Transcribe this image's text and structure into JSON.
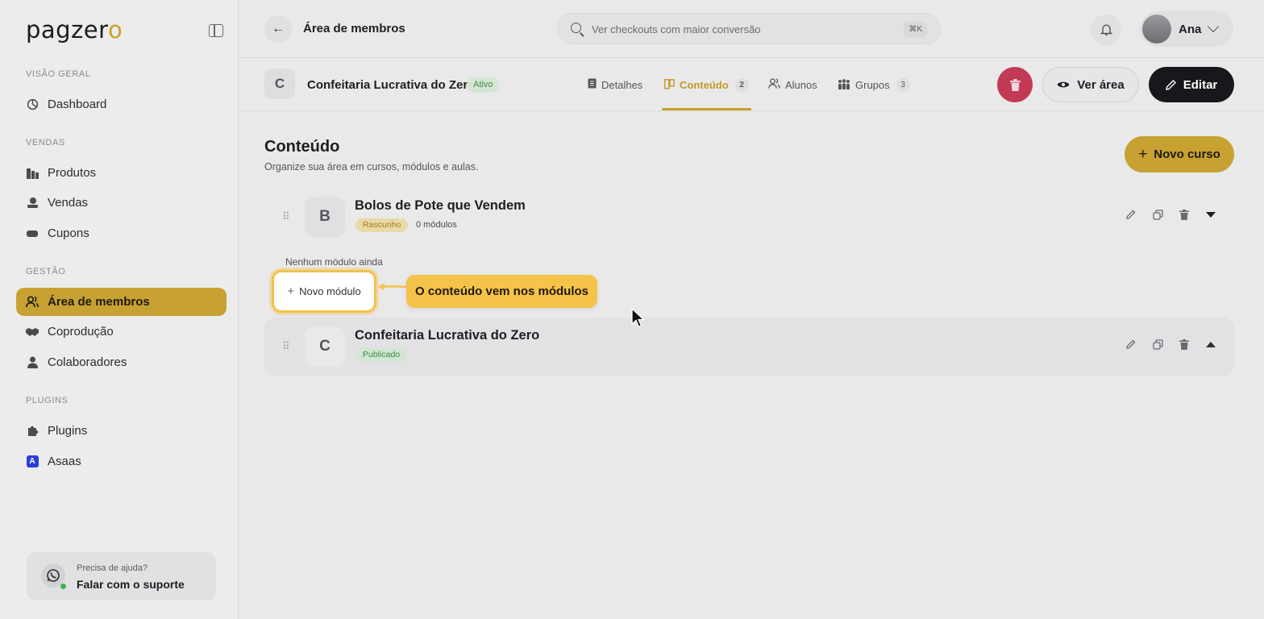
{
  "app": {
    "logo_main": "pagzer",
    "logo_accent": "o"
  },
  "sidebar": {
    "sections": [
      {
        "label": "VISÃO GERAL",
        "items": [
          {
            "label": "Dashboard",
            "icon": "dashboard-icon"
          }
        ]
      },
      {
        "label": "VENDAS",
        "items": [
          {
            "label": "Produtos",
            "icon": "products-icon"
          },
          {
            "label": "Vendas",
            "icon": "sales-icon"
          },
          {
            "label": "Cupons",
            "icon": "coupon-icon"
          }
        ]
      },
      {
        "label": "GESTÃO",
        "items": [
          {
            "label": "Área de membros",
            "icon": "members-icon",
            "active": true
          },
          {
            "label": "Coprodução",
            "icon": "handshake-icon"
          },
          {
            "label": "Colaboradores",
            "icon": "user-icon"
          }
        ]
      },
      {
        "label": "PLUGINS",
        "items": [
          {
            "label": "Plugins",
            "icon": "puzzle-icon"
          },
          {
            "label": "Asaas",
            "icon": "asaas-icon"
          }
        ]
      }
    ],
    "support": {
      "question": "Precisa de ajuda?",
      "action": "Falar com o suporte"
    }
  },
  "topbar": {
    "title": "Área de membros",
    "search_placeholder": "Ver checkouts com maior conversão",
    "search_shortcut": "⌘K",
    "user_name": "Ana"
  },
  "course_header": {
    "letter": "C",
    "name": "Confeitaria Lucrativa do Zero",
    "status": "Ativo",
    "tabs": [
      {
        "label": "Detalhes",
        "count": null
      },
      {
        "label": "Conteúdo",
        "count": "2",
        "active": true
      },
      {
        "label": "Alunos",
        "count": null
      },
      {
        "label": "Grupos",
        "count": "3"
      }
    ],
    "view_label": "Ver área",
    "edit_label": "Editar"
  },
  "content": {
    "title": "Conteúdo",
    "subtitle": "Organize sua área em cursos, módulos e aulas.",
    "new_course_label": "Novo curso",
    "courses": [
      {
        "letter": "B",
        "name": "Bolos de Pote que Vendem",
        "status": "Rascunho",
        "modules": "0 módulos",
        "expanded": true
      },
      {
        "letter": "C",
        "name": "Confeitaria Lucrativa do Zero",
        "status": "Publicado",
        "expanded": false
      }
    ],
    "empty_modules": "Nenhum módulo ainda",
    "new_module_label": "Novo módulo",
    "tooltip": "O conteúdo vem nos módulos"
  },
  "colors": {
    "accent": "#c7a233",
    "danger": "#c23a55",
    "dark": "#17181c",
    "tooltip": "#f5c24a"
  }
}
